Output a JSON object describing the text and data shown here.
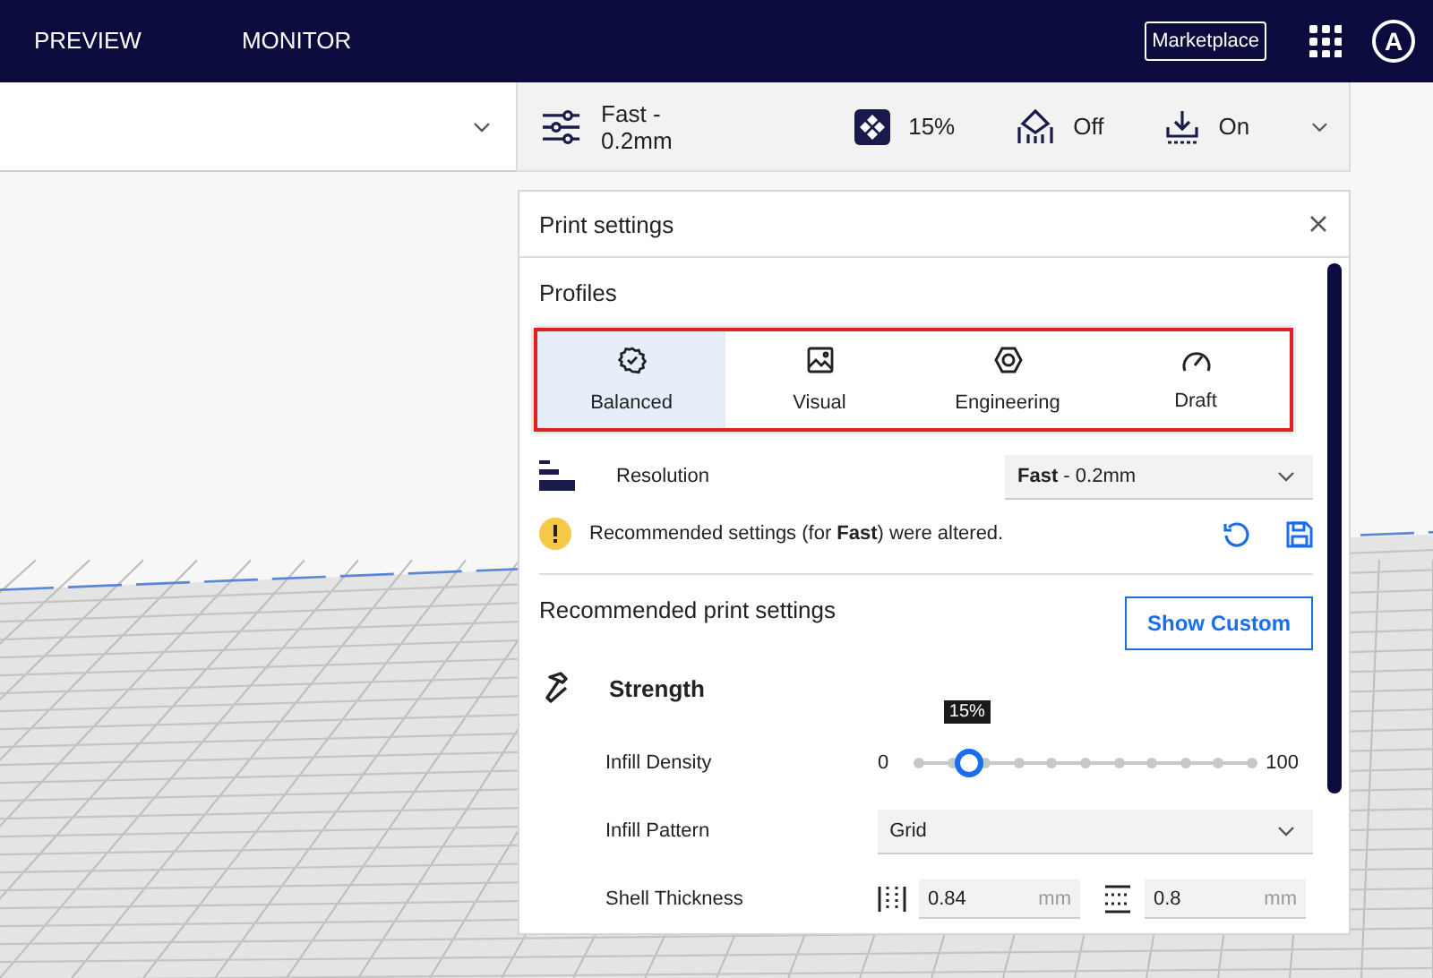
{
  "header": {
    "tabs": [
      {
        "label": "PREVIEW",
        "selected": false
      },
      {
        "label": "MONITOR",
        "selected": false
      }
    ],
    "marketplace_button": "Marketplace",
    "avatar": "A"
  },
  "toolbar": {
    "profile": "Fast - 0.2mm",
    "infill": "15%",
    "support": "Off",
    "adhesion": "On"
  },
  "print_settings": {
    "title": "Print settings",
    "profiles_label": "Profiles",
    "highlighted": true,
    "profiles": [
      {
        "kind": "balanced",
        "label": "Balanced",
        "selected": true
      },
      {
        "kind": "visual",
        "label": "Visual",
        "selected": false
      },
      {
        "kind": "engineering",
        "label": "Engineering",
        "selected": false
      },
      {
        "kind": "draft",
        "label": "Draft",
        "selected": false
      }
    ],
    "resolution": {
      "label": "Resolution",
      "value": "**Fast** - 0.2mm"
    },
    "alert": "Recommended settings (for **Fast**) were altered.",
    "recommended_title": "Recommended print settings",
    "show_custom_button": "Show Custom",
    "strength": {
      "title": "Strength",
      "infill_density": {
        "label": "Infill Density",
        "min": "0",
        "max": "100",
        "level": 0.15,
        "tooltip": "15%"
      },
      "infill_pattern": {
        "label": "Infill Pattern",
        "value": "Grid"
      },
      "shell_thickness": {
        "label": "Shell Thickness",
        "wall": {
          "value": "0.84",
          "unit": "mm"
        },
        "top_bottom": {
          "value": "0.8",
          "unit": "mm"
        }
      }
    }
  }
}
